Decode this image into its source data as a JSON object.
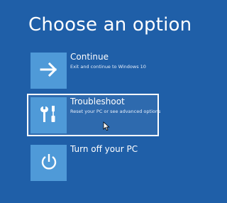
{
  "page": {
    "title": "Choose an option",
    "background_color": "#1f5fa8",
    "tile_color": "#4f9ad8"
  },
  "options": [
    {
      "label": "Continue",
      "description": "Exit and continue to Windows 10",
      "icon": "arrow-right-icon",
      "selected": false
    },
    {
      "label": "Troubleshoot",
      "description": "Reset your PC or see advanced options",
      "icon": "tools-icon",
      "selected": true
    },
    {
      "label": "Turn off your PC",
      "description": "",
      "icon": "power-icon",
      "selected": false
    }
  ]
}
